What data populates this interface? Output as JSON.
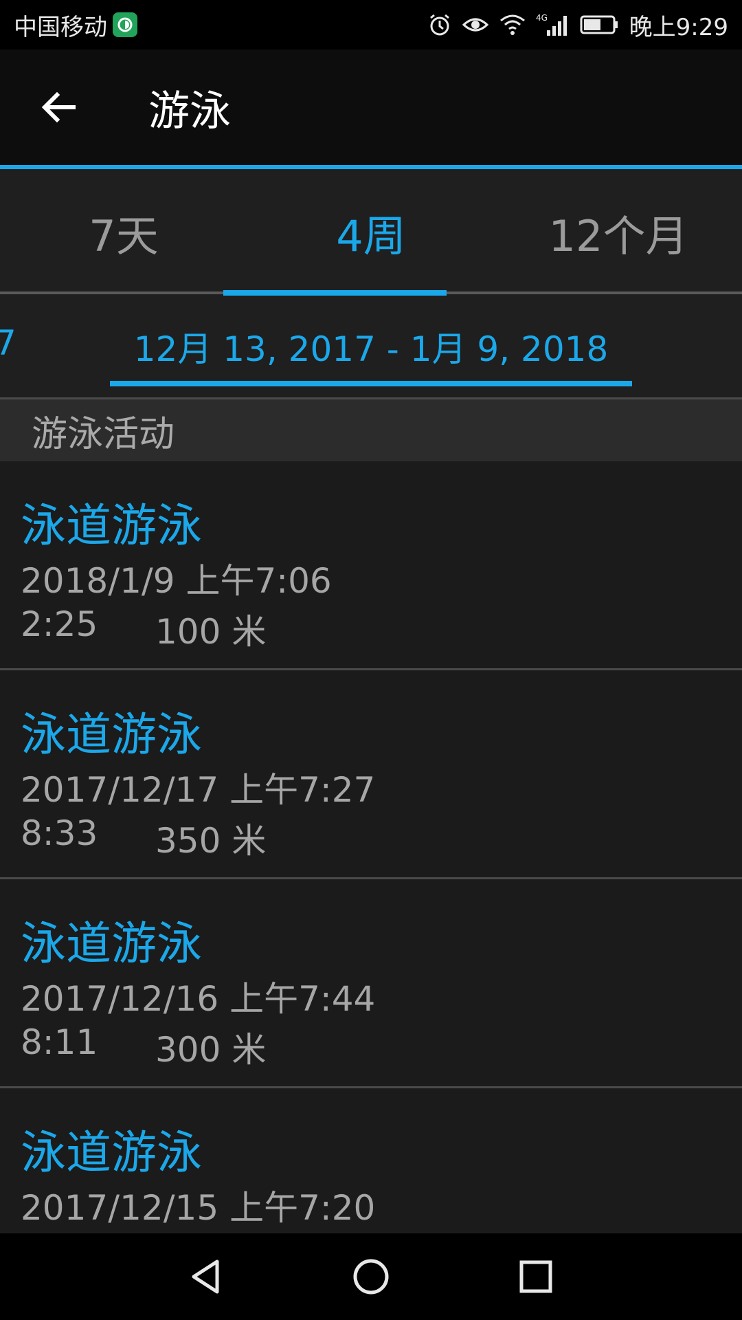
{
  "status_bar": {
    "carrier": "中国移动",
    "network": "4G",
    "time": "晚上9:29"
  },
  "app_bar": {
    "title": "游泳",
    "back_icon": "arrow-left-icon"
  },
  "tabs": [
    {
      "label": "7天",
      "active": false
    },
    {
      "label": "4周",
      "active": true
    },
    {
      "label": "12个月",
      "active": false
    }
  ],
  "date_range": {
    "prev_peek": "7",
    "current": "12月 13, 2017 - 1月 9, 2018"
  },
  "section": {
    "title": "游泳活动"
  },
  "activities": [
    {
      "title": "泳道游泳",
      "datetime": "2018/1/9 上午7:06",
      "duration": "2:25",
      "distance": "100 米"
    },
    {
      "title": "泳道游泳",
      "datetime": "2017/12/17 上午7:27",
      "duration": "8:33",
      "distance": "350 米"
    },
    {
      "title": "泳道游泳",
      "datetime": "2017/12/16 上午7:44",
      "duration": "8:11",
      "distance": "300 米"
    },
    {
      "title": "泳道游泳",
      "datetime": "2017/12/15 上午7:20",
      "duration": "",
      "distance": ""
    }
  ],
  "colors": {
    "accent": "#1ba8ea",
    "background": "#1b1b1b",
    "secondary_text": "#a6a6a6"
  }
}
